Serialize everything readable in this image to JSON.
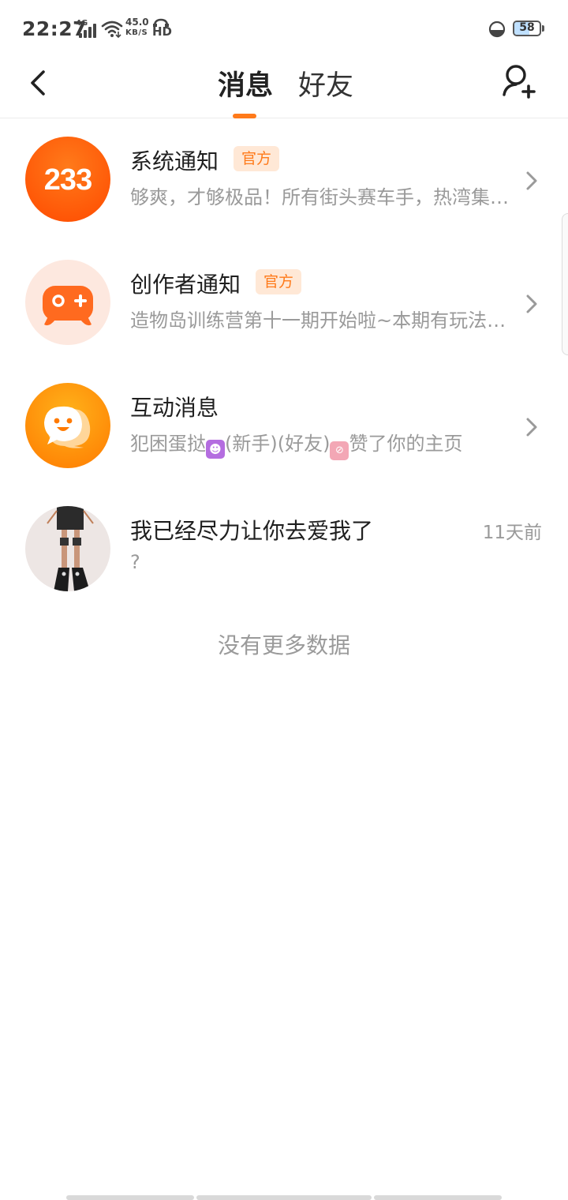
{
  "status_bar": {
    "time": "22:27",
    "network": "4G",
    "speed_value": "45.0",
    "speed_unit": "KB/S",
    "hd": "HD",
    "battery": "58"
  },
  "header": {
    "tabs": [
      {
        "label": "消息",
        "active": true
      },
      {
        "label": "好友",
        "active": false
      }
    ]
  },
  "messages": [
    {
      "title": "系统通知",
      "badge": "官方",
      "subtitle": "够爽，才够极品！所有街头赛车手，热湾集结出发！",
      "avatar_icon": "233-logo-icon"
    },
    {
      "title": "创作者通知",
      "badge": "官方",
      "subtitle": "造物岛训练营第十一期开始啦~本期有玩法教学和奖励",
      "avatar_icon": "gamepad-icon"
    },
    {
      "title": "互动消息",
      "subtitle_parts": [
        "犯困蛋挞",
        "(新手)(好友)",
        "赞了你的主页"
      ],
      "avatar_icon": "chat-bubble-icon"
    },
    {
      "title": "我已经尽力让你去爱我了",
      "time": "11天前",
      "subtitle": "?",
      "avatar_icon": "user-photo"
    }
  ],
  "footer_text": "没有更多数据",
  "colors": {
    "accent": "#ff7a1a",
    "badge_bg": "#ffe8d6",
    "secondary_text": "#9a9a9a"
  }
}
